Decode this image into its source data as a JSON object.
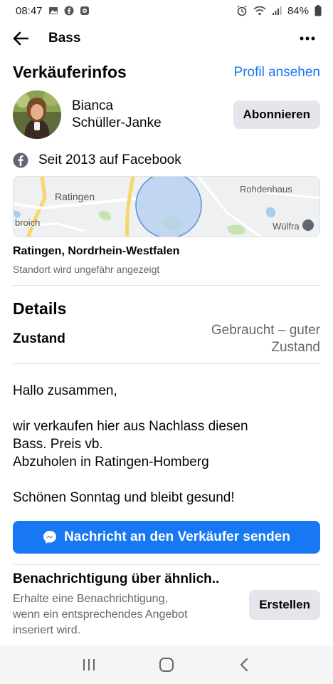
{
  "status_bar": {
    "time": "08:47",
    "battery": "84%",
    "icons_left": [
      "gallery-icon",
      "facebook-icon",
      "messenger-icon"
    ],
    "icons_right": [
      "alarm-icon",
      "wifi-icon",
      "signal-icon",
      "battery-icon"
    ]
  },
  "app_bar": {
    "title": "Bass"
  },
  "seller": {
    "section_title": "Verkäuferinfos",
    "profile_link": "Profil ansehen",
    "name_line1": "Bianca",
    "name_line2": "Schüller-Janke",
    "subscribe_label": "Abonnieren",
    "since": "Seit 2013 auf Facebook"
  },
  "map": {
    "labels": [
      "Ratingen",
      "Rohdenhaus",
      "broich",
      "Wülfra"
    ]
  },
  "location": {
    "name": "Ratingen, Nordrhein-Westfalen",
    "note": "Standort wird ungefähr angezeigt"
  },
  "details": {
    "title": "Details",
    "condition_label": "Zustand",
    "condition_value_line1": "Gebraucht – guter",
    "condition_value_line2": "Zustand"
  },
  "description": {
    "line1": "Hallo zusammen,",
    "line2": "wir verkaufen hier aus Nachlass diesen",
    "line3": "Bass. Preis vb.",
    "line4": "Abzuholen in Ratingen-Homberg",
    "line5": "Schönen Sonntag und bleibt gesund!"
  },
  "message_button": {
    "label": "Nachricht an den Verkäufer senden"
  },
  "notification": {
    "title": "Benachrichtigung über ähnlich..",
    "text_line1": "Erhalte eine Benachrichtigung,",
    "text_line2": "wenn ein entsprechendes Angebot",
    "text_line3": "inseriert wird.",
    "create_label": "Erstellen"
  },
  "colors": {
    "accent": "#1877f2",
    "secondary_button": "#e4e6eb",
    "muted_text": "#65676b"
  }
}
